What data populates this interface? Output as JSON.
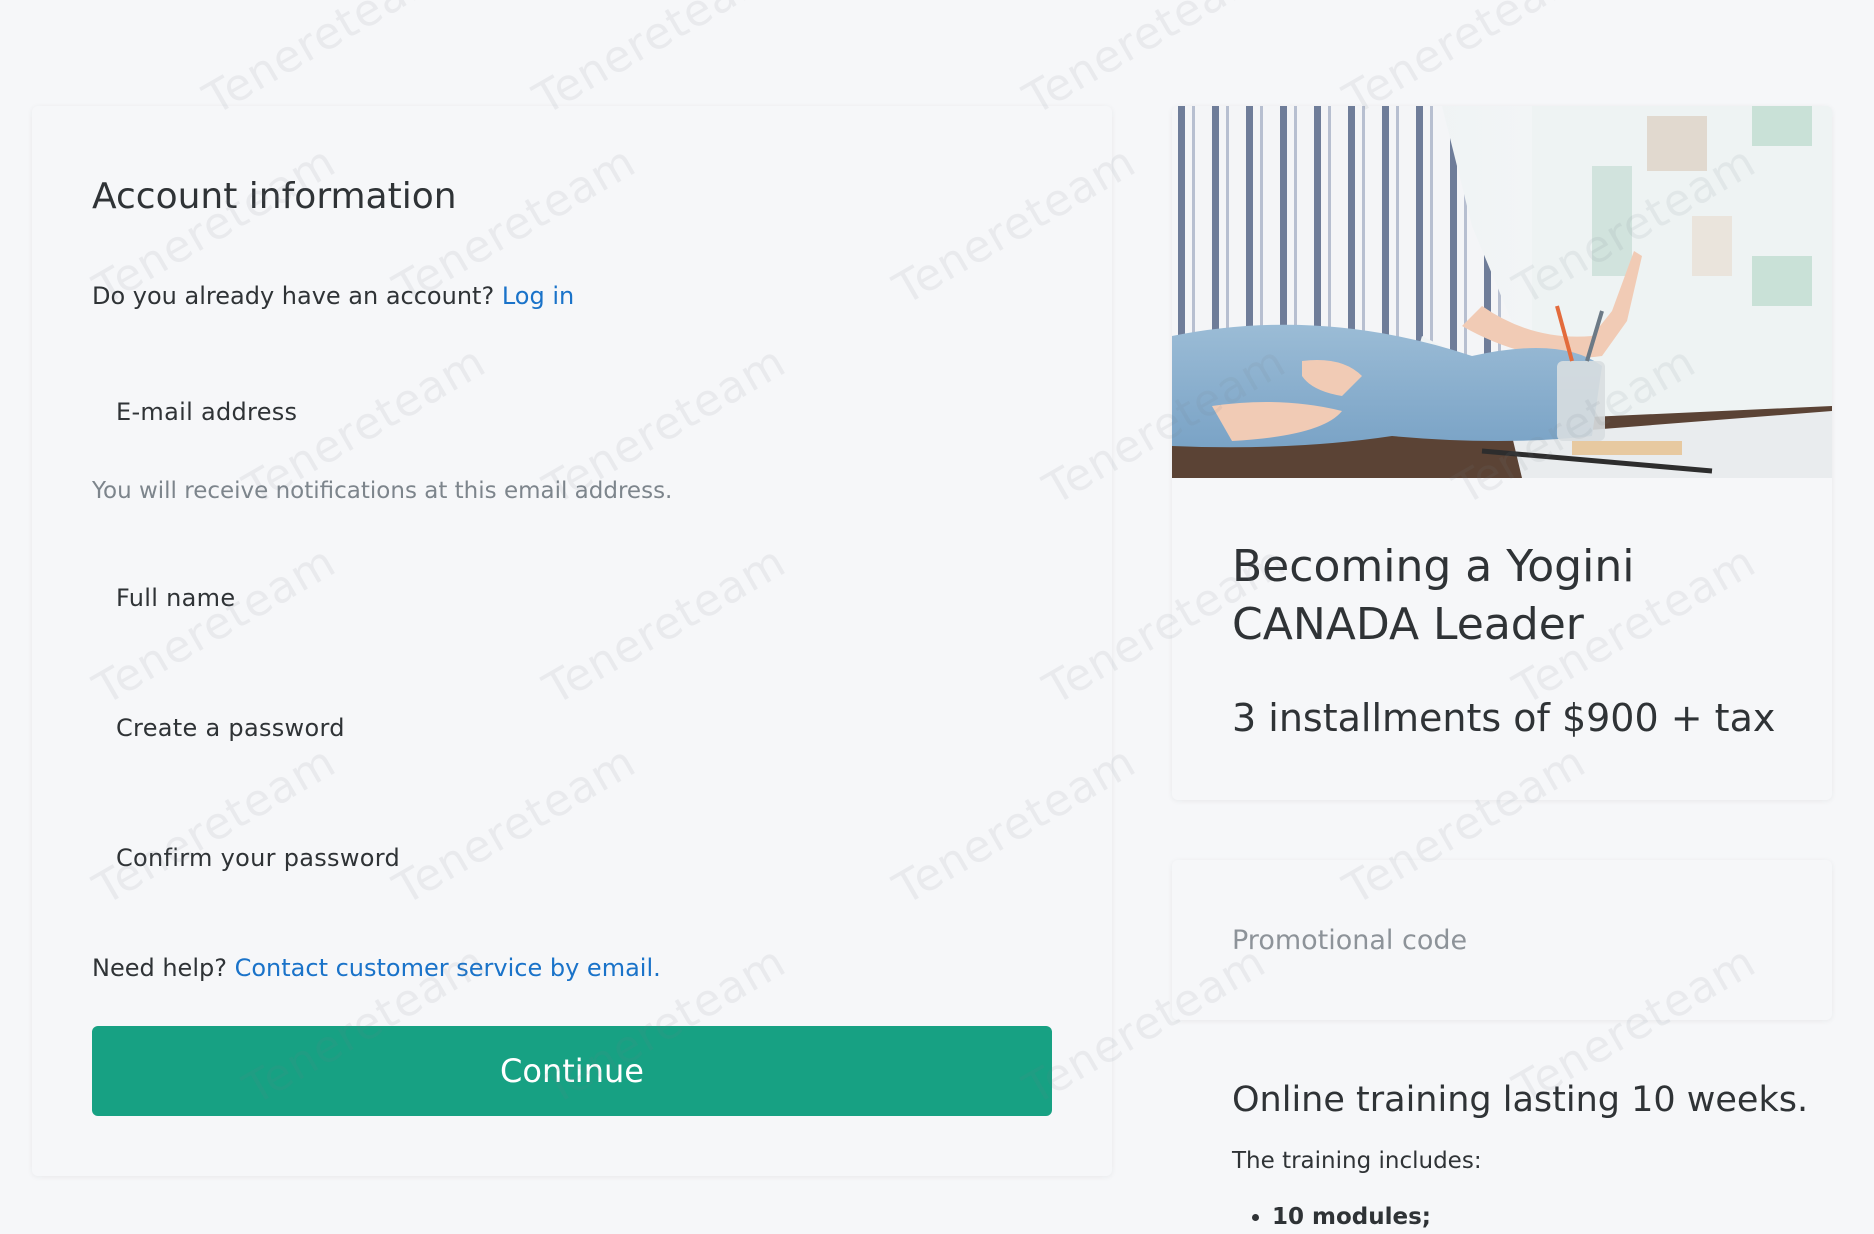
{
  "account_form": {
    "title": "Account information",
    "login_prompt": "Do you already have an account?",
    "login_link": "Log in",
    "email_label": "E-mail address",
    "email_helper": "You will receive notifications at this email address.",
    "fullname_label": "Full name",
    "password_label": "Create a password",
    "confirm_password_label": "Confirm your password",
    "help_prompt": "Need help?",
    "help_link": "Contact customer service by email.",
    "continue_label": "Continue"
  },
  "product": {
    "title_line1": "Becoming a Yogini",
    "title_line2": "CANADA Leader",
    "price": "3 installments of $900 + tax"
  },
  "promo": {
    "placeholder": "Promotional code"
  },
  "training": {
    "title": "Online training lasting 10 weeks.",
    "intro": "The training includes:",
    "items": [
      "10 modules;"
    ]
  },
  "watermark": {
    "text": "Tenereteam"
  },
  "colors": {
    "accent": "#17a183",
    "link": "#1a73c9",
    "text": "#2f3336",
    "muted": "#7d858c",
    "background": "#f6f7f9"
  }
}
